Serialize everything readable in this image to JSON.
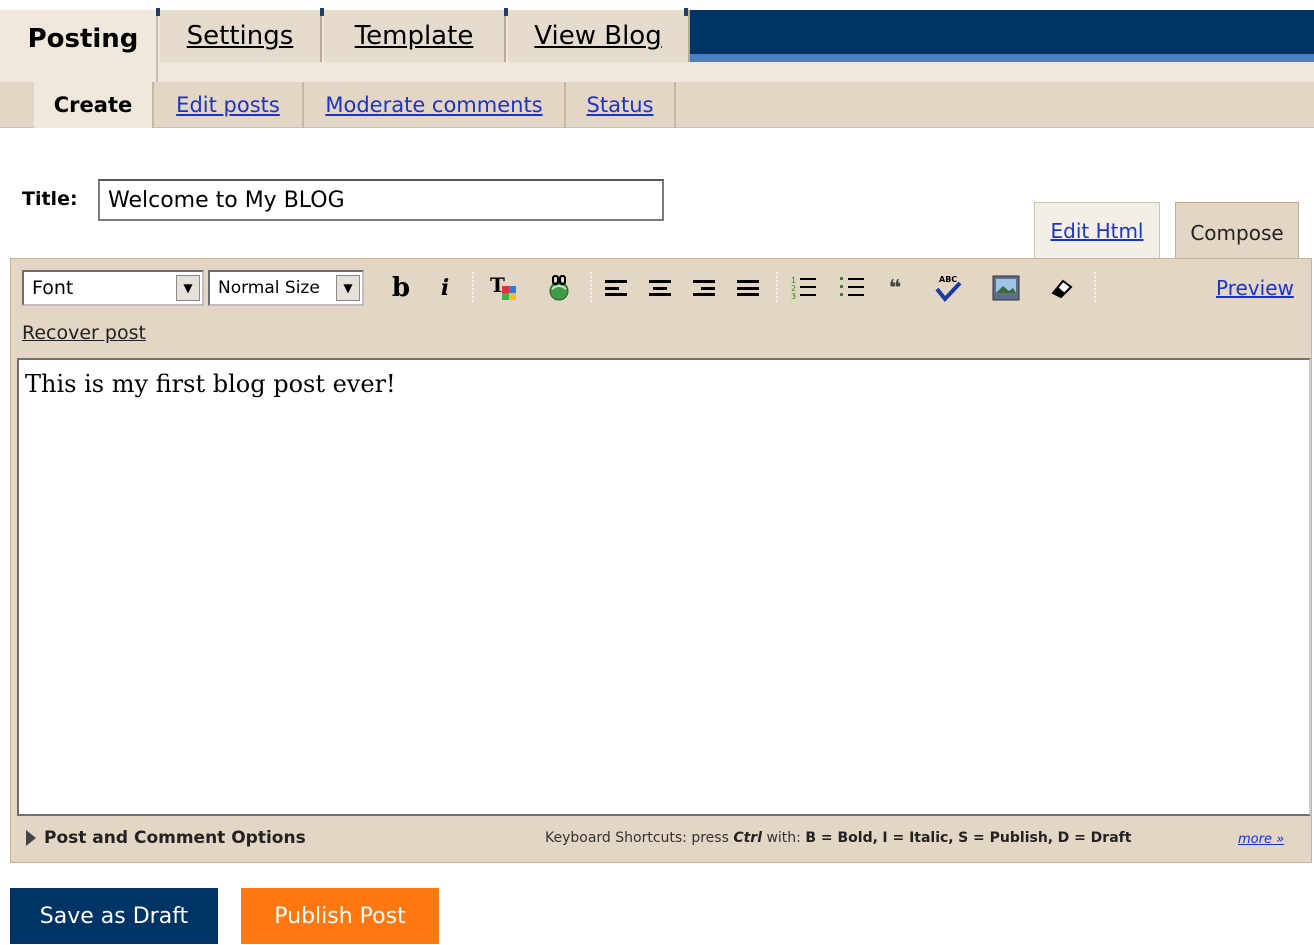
{
  "tabs": {
    "main": [
      "Posting",
      "Settings",
      "Template",
      "View Blog"
    ],
    "sub": [
      "Create",
      "Edit posts",
      "Moderate comments",
      "Status"
    ]
  },
  "post": {
    "title_label": "Title:",
    "title_value": "Welcome to My BLOG",
    "body": "This is my first blog post ever!"
  },
  "modes": {
    "edit_html": "Edit Html",
    "compose": "Compose"
  },
  "toolbar": {
    "font_select": "Font",
    "size_select": "Normal Size",
    "bold_glyph": "b",
    "italic_glyph": "i",
    "icons": [
      "text-color-icon",
      "link-icon",
      "align-left-icon",
      "align-center-icon",
      "align-right-icon",
      "align-justify-icon",
      "numbered-list-icon",
      "bullet-list-icon",
      "blockquote-icon",
      "spellcheck-icon",
      "image-icon",
      "eraser-icon"
    ],
    "preview": "Preview",
    "recover": "Recover post"
  },
  "footer": {
    "options": "Post and Comment Options",
    "shortcuts_intro": "Keyboard Shortcuts: press",
    "ctrl": "Ctrl",
    "with": "with:",
    "sc_b": "B = Bold,",
    "sc_i": "I = Italic,",
    "sc_s": "S = Publish,",
    "sc_d": "D = Draft",
    "more": "more »"
  },
  "buttons": {
    "save_draft": "Save as Draft",
    "publish": "Publish Post"
  },
  "colors": {
    "navy": "#003366",
    "orange": "#ff7711",
    "beige": "#e3d6c4",
    "link": "#1a33cc"
  }
}
